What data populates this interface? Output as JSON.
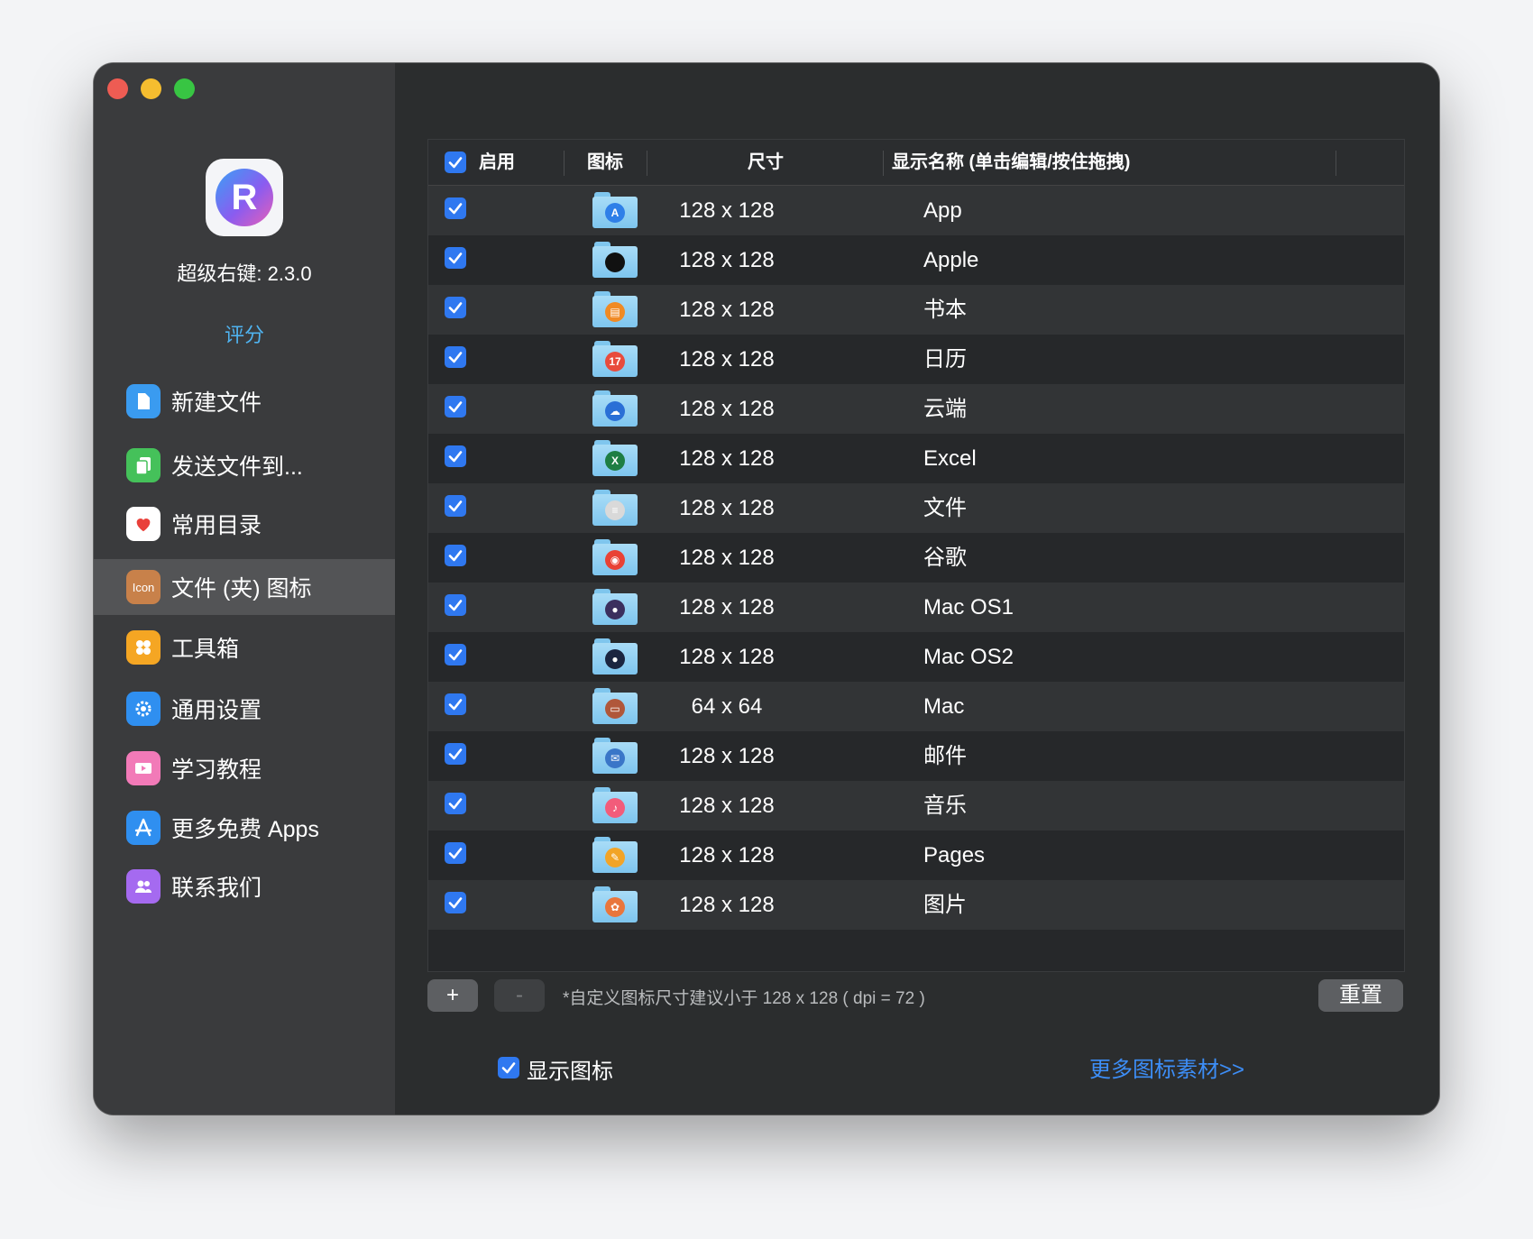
{
  "window": {
    "traffic_lights": [
      "close",
      "minimize",
      "zoom"
    ]
  },
  "app": {
    "version_label": "超级右键: 2.3.0",
    "logo_letter": "R",
    "rate_label": "评分"
  },
  "sidebar": {
    "items": [
      {
        "label": "新建文件",
        "icon": "new-file-icon",
        "color": "#3a9bf0"
      },
      {
        "label": "发送文件到...",
        "icon": "send-files-icon",
        "color": "#45c15a"
      },
      {
        "label": "常用目录",
        "icon": "heart-icon",
        "color": "#ffffff"
      },
      {
        "label": "文件 (夹) 图标",
        "icon": "folder-icon-icon",
        "color": "#c8814a"
      },
      {
        "label": "工具箱",
        "icon": "toolbox-icon",
        "color": "#f5a623"
      },
      {
        "label": "通用设置",
        "icon": "gear-icon",
        "color": "#2f8ff0"
      },
      {
        "label": "学习教程",
        "icon": "video-icon",
        "color": "#f27ab8"
      },
      {
        "label": "更多免费 Apps",
        "icon": "app-store-icon",
        "color": "#2f8ff0"
      },
      {
        "label": "联系我们",
        "icon": "contacts-icon",
        "color": "#a56af0"
      }
    ],
    "active_index": 3,
    "icon_text": "Icon"
  },
  "table": {
    "headers": {
      "enable": "启用",
      "icon": "图标",
      "size": "尺寸",
      "name": "显示名称 (单击编辑/按住拖拽)"
    },
    "header_checked": true,
    "rows": [
      {
        "checked": true,
        "icon": "app-store-folder-icon",
        "glyph_color": "#2f7fe8",
        "size": "128 x 128",
        "name": "App"
      },
      {
        "checked": true,
        "icon": "apple-folder-icon",
        "glyph_color": "#111111",
        "size": "128 x 128",
        "name": "Apple"
      },
      {
        "checked": true,
        "icon": "books-folder-icon",
        "glyph_color": "#f08a24",
        "size": "128 x 128",
        "name": "书本"
      },
      {
        "checked": true,
        "icon": "calendar-folder-icon",
        "glyph_color": "#e84b3c",
        "size": "128 x 128",
        "name": "日历"
      },
      {
        "checked": true,
        "icon": "cloud-folder-icon",
        "glyph_color": "#2a6fd6",
        "size": "128 x 128",
        "name": "云端"
      },
      {
        "checked": true,
        "icon": "excel-folder-icon",
        "glyph_color": "#1e7e43",
        "size": "128 x 128",
        "name": "Excel"
      },
      {
        "checked": true,
        "icon": "document-folder-icon",
        "glyph_color": "#d9d9d9",
        "size": "128 x 128",
        "name": "文件"
      },
      {
        "checked": true,
        "icon": "chrome-folder-icon",
        "glyph_color": "#e94235",
        "size": "128 x 128",
        "name": "谷歌"
      },
      {
        "checked": true,
        "icon": "macos-folder-icon",
        "glyph_color": "#3b2f5e",
        "size": "128 x 128",
        "name": "Mac OS1"
      },
      {
        "checked": true,
        "icon": "macos-folder-icon",
        "glyph_color": "#1b2540",
        "size": "128 x 128",
        "name": "Mac OS2"
      },
      {
        "checked": true,
        "icon": "mac-folder-icon",
        "glyph_color": "#b0573a",
        "size": "64 x 64",
        "name": "Mac"
      },
      {
        "checked": true,
        "icon": "mail-folder-icon",
        "glyph_color": "#3a76c8",
        "size": "128 x 128",
        "name": "邮件"
      },
      {
        "checked": true,
        "icon": "music-folder-icon",
        "glyph_color": "#f25c7a",
        "size": "128 x 128",
        "name": "音乐"
      },
      {
        "checked": true,
        "icon": "pages-folder-icon",
        "glyph_color": "#f2a427",
        "size": "128 x 128",
        "name": "Pages"
      },
      {
        "checked": true,
        "icon": "photos-folder-icon",
        "glyph_color": "#e9763c",
        "size": "128 x 128",
        "name": "图片"
      }
    ]
  },
  "controls": {
    "add_label": "+",
    "remove_label": "-",
    "hint": "*自定义图标尺寸建议小于 128 x 128 ( dpi = 72 )",
    "reset_label": "重置",
    "show_icon_label": "显示图标",
    "show_icon_checked": true,
    "more_link": "更多图标素材>>"
  },
  "colors": {
    "accent": "#2f78f0",
    "link": "#3d8ef7",
    "rate": "#4fb3f0"
  }
}
